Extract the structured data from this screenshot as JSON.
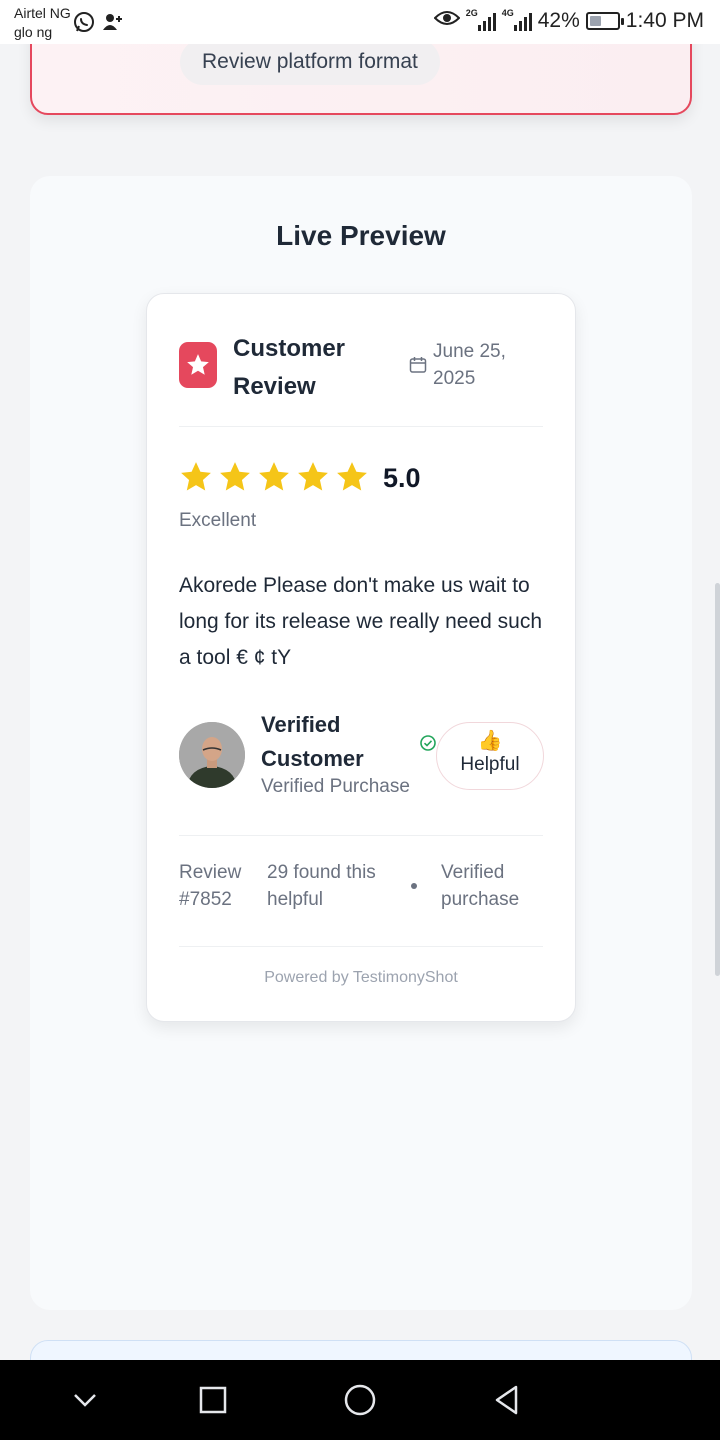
{
  "status_bar": {
    "carrier_1": "Airtel NG",
    "carrier_2": "glo ng",
    "net_1": "2G",
    "net_2": "4G",
    "battery": "42%",
    "battery_level": 0.42,
    "time": "1:40 PM"
  },
  "top_section": {
    "format_pill": "Review platform format"
  },
  "preview": {
    "title": "Live Preview",
    "card": {
      "title": "Customer Review",
      "date": "June 25, 2025",
      "stars": 5,
      "rating": "5.0",
      "rating_label": "Excellent",
      "text": "Akorede Please don't make us wait to long for its release we really need such a tool € ¢ tY",
      "reviewer": {
        "name": "Verified Customer",
        "subtitle": "Verified Purchase"
      },
      "helpful": {
        "icon": "👍",
        "label": "Helpful"
      },
      "meta": {
        "review_id": "Review #7852",
        "helpful_count": "29 found this helpful",
        "verified": "Verified purchase"
      },
      "footer": "Powered by TestimonyShot"
    }
  },
  "colors": {
    "accent": "#e5485d",
    "star": "#f5c518",
    "verified": "#22a55b"
  }
}
